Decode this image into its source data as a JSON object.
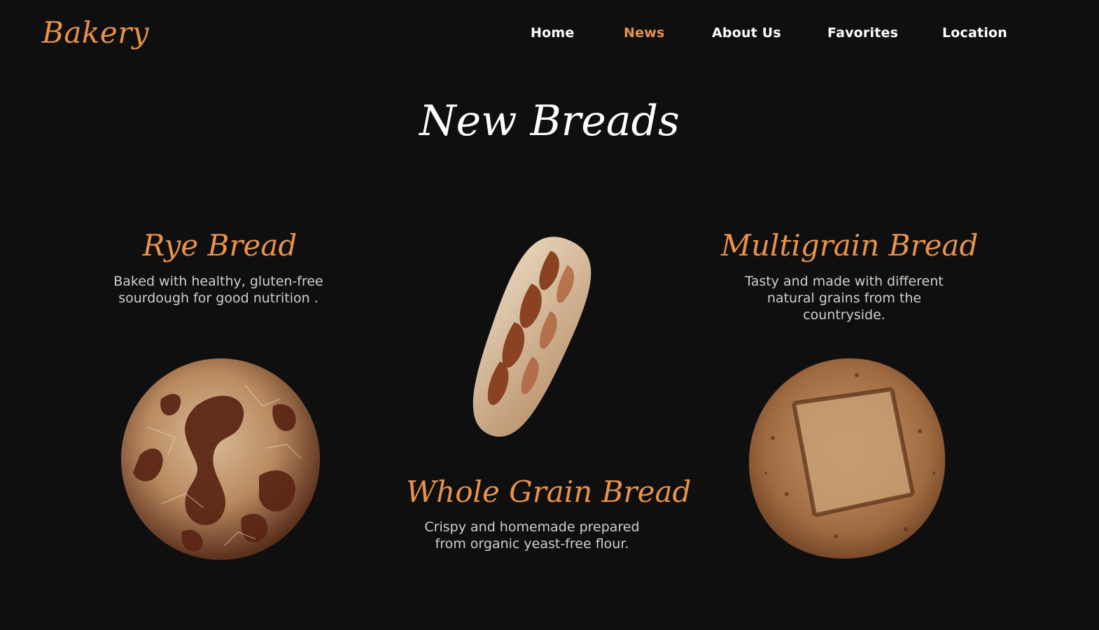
{
  "brand": {
    "logo": "Bakery",
    "accent_color": "#e9924a",
    "background_color": "#0f0f10"
  },
  "nav": {
    "items": [
      {
        "label": "Home",
        "active": false
      },
      {
        "label": "News",
        "active": true
      },
      {
        "label": "About Us",
        "active": false
      },
      {
        "label": "Favorites",
        "active": false
      },
      {
        "label": "Location",
        "active": false
      }
    ]
  },
  "section": {
    "title": "New Breads"
  },
  "breads": {
    "rye": {
      "name": "Rye Bread",
      "description": "Baked with healthy, gluten-free sourdough for good nutrition ."
    },
    "whole_grain": {
      "name": "Whole Grain Bread",
      "description": "Crispy and homemade prepared from organic yeast-free flour."
    },
    "multigrain": {
      "name": "Multigrain Bread",
      "description": "Tasty and made with different natural grains from the countryside."
    }
  }
}
